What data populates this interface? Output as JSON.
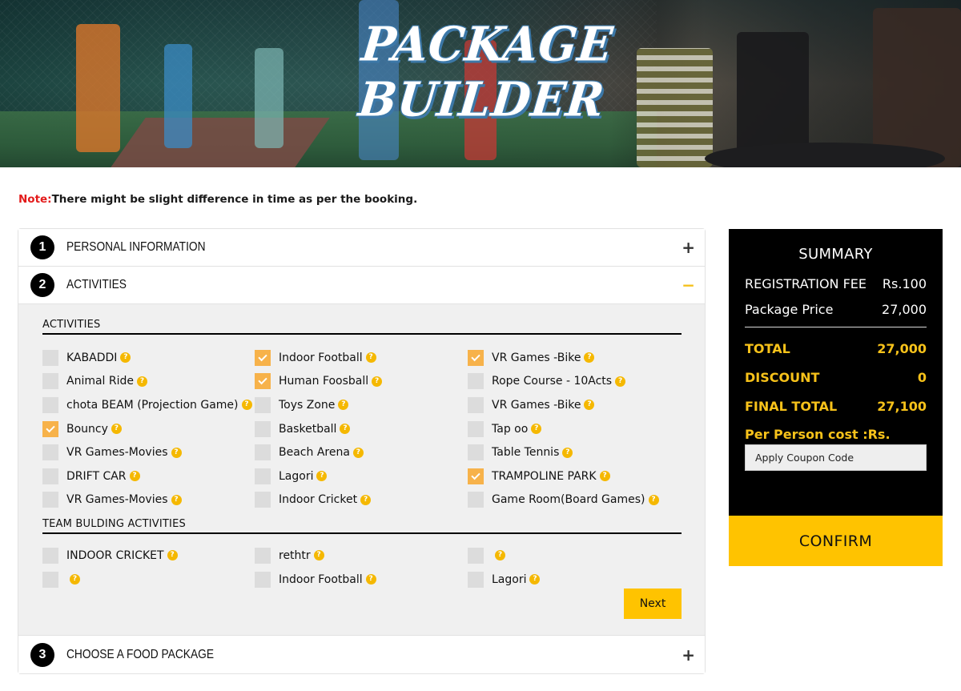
{
  "banner": {
    "title": "PACKAGE BUILDER"
  },
  "note": {
    "label": "Note:",
    "text": "There might be slight difference in time as per the booking."
  },
  "accordion": {
    "steps": [
      {
        "number": "1",
        "title": "PERSONAL INFORMATION",
        "toggle": "+"
      },
      {
        "number": "2",
        "title": "ACTIVITIES",
        "toggle": "−"
      },
      {
        "number": "3",
        "title": "CHOOSE A FOOD PACKAGE",
        "toggle": "+"
      }
    ]
  },
  "activities": {
    "section_title": "ACTIVITIES",
    "help_glyph": "?",
    "items": [
      {
        "label": "KABADDI",
        "checked": false
      },
      {
        "label": "Indoor Football",
        "checked": true
      },
      {
        "label": "VR Games -Bike",
        "checked": true
      },
      {
        "label": "Animal Ride",
        "checked": false
      },
      {
        "label": "Human Foosball",
        "checked": true
      },
      {
        "label": "Rope Course - 10Acts",
        "checked": false
      },
      {
        "label": "chota BEAM (Projection Game)",
        "checked": false
      },
      {
        "label": "Toys Zone",
        "checked": false
      },
      {
        "label": "VR Games -Bike",
        "checked": false
      },
      {
        "label": "Bouncy",
        "checked": true
      },
      {
        "label": "Basketball",
        "checked": false
      },
      {
        "label": "Tap oo",
        "checked": false
      },
      {
        "label": "VR Games-Movies",
        "checked": false
      },
      {
        "label": "Beach Arena",
        "checked": false
      },
      {
        "label": "Table Tennis",
        "checked": false
      },
      {
        "label": "DRIFT CAR",
        "checked": false
      },
      {
        "label": "Lagori",
        "checked": false
      },
      {
        "label": "TRAMPOLINE PARK",
        "checked": true
      },
      {
        "label": "VR Games-Movies",
        "checked": false
      },
      {
        "label": "Indoor Cricket",
        "checked": false
      },
      {
        "label": "Game Room(Board Games)",
        "checked": false
      }
    ]
  },
  "team_building": {
    "section_title": "TEAM BULDING ACTIVITIES",
    "items": [
      {
        "label": "INDOOR CRICKET",
        "checked": false
      },
      {
        "label": "rethtr",
        "checked": false
      },
      {
        "label": "",
        "checked": false
      },
      {
        "label": "",
        "checked": false
      },
      {
        "label": "Indoor Football",
        "checked": false
      },
      {
        "label": "Lagori",
        "checked": false
      }
    ]
  },
  "next_label": "Next",
  "summary": {
    "title": "SUMMARY",
    "registration_fee_label": "REGISTRATION FEE",
    "registration_fee_value": "Rs.100",
    "package_price_label": "Package Price",
    "package_price_value": "27,000",
    "total_label": "TOTAL",
    "total_value": "27,000",
    "discount_label": "DISCOUNT",
    "discount_value": "0",
    "final_total_label": "FINAL TOTAL",
    "final_total_value": "27,100",
    "per_person_label": "Per Person cost :Rs.",
    "coupon_placeholder": "Apply Coupon Code",
    "confirm_label": "CONFIRM"
  },
  "colors": {
    "accent_yellow": "#ffc300",
    "checkbox_checked": "#f7b24a",
    "note_red": "#e31b1b",
    "summary_bg": "#000000",
    "summary_highlight": "#f7c21a"
  }
}
